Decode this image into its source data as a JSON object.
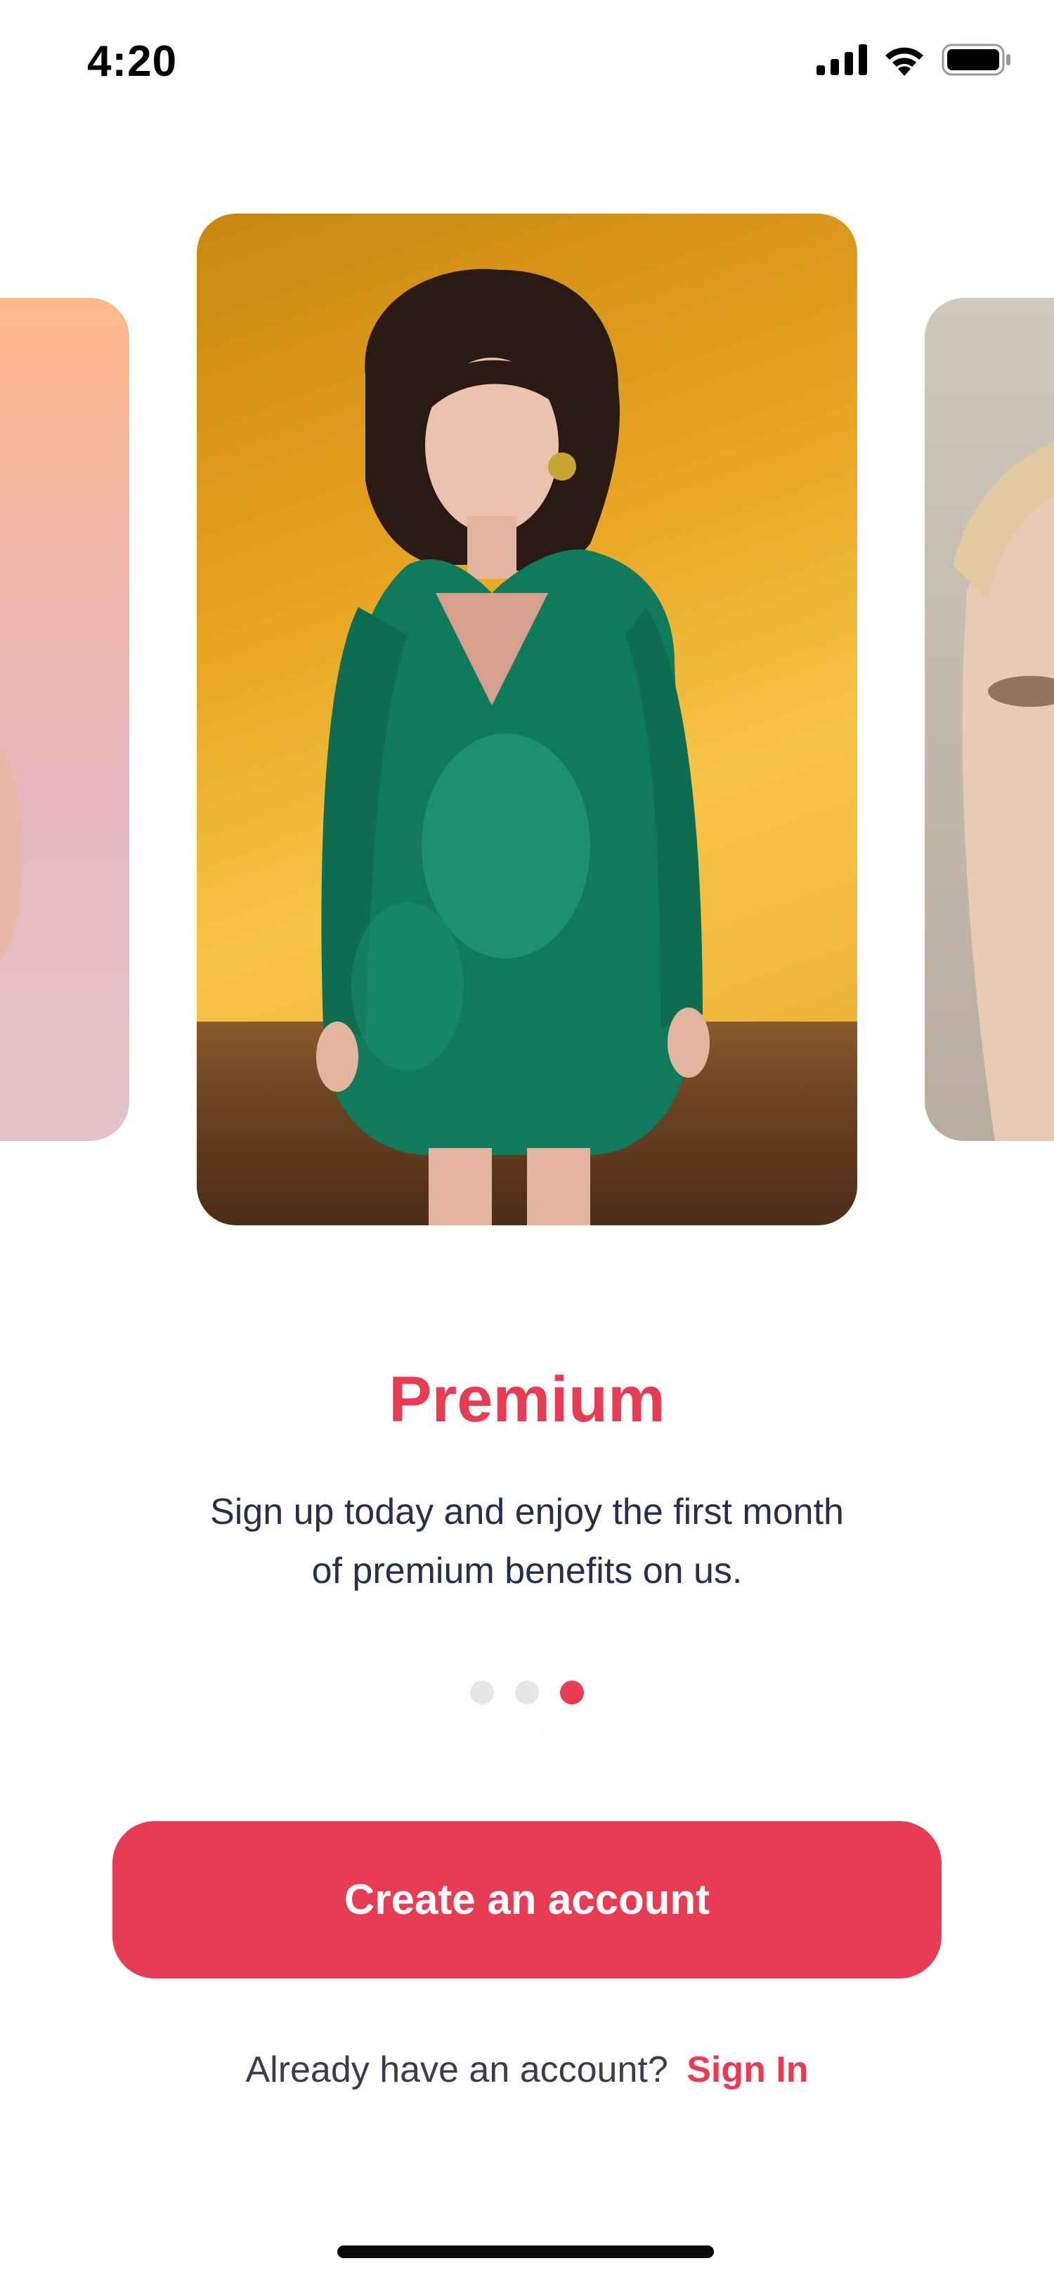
{
  "status_bar": {
    "time": "4:20",
    "icons": [
      "cellular-signal-icon",
      "wifi-icon",
      "battery-icon"
    ]
  },
  "carousel": {
    "active_index": 2,
    "total": 3,
    "cards": [
      {
        "position": "left",
        "image": "woman-pink-background-photo"
      },
      {
        "position": "center",
        "image": "woman-green-sequin-dress-photo"
      },
      {
        "position": "right",
        "image": "blonde-woman-portrait-photo"
      }
    ]
  },
  "content": {
    "title": "Premium",
    "description_line1": "Sign up today and enjoy the first month",
    "description_line2": "of premium benefits on us."
  },
  "actions": {
    "create_account_label": "Create an account",
    "signin_prompt": "Already have an account?",
    "signin_label": "Sign In"
  },
  "colors": {
    "accent": "#e83c55",
    "text_dark": "#2a2e4a",
    "dot_inactive": "#e6e6e8"
  }
}
